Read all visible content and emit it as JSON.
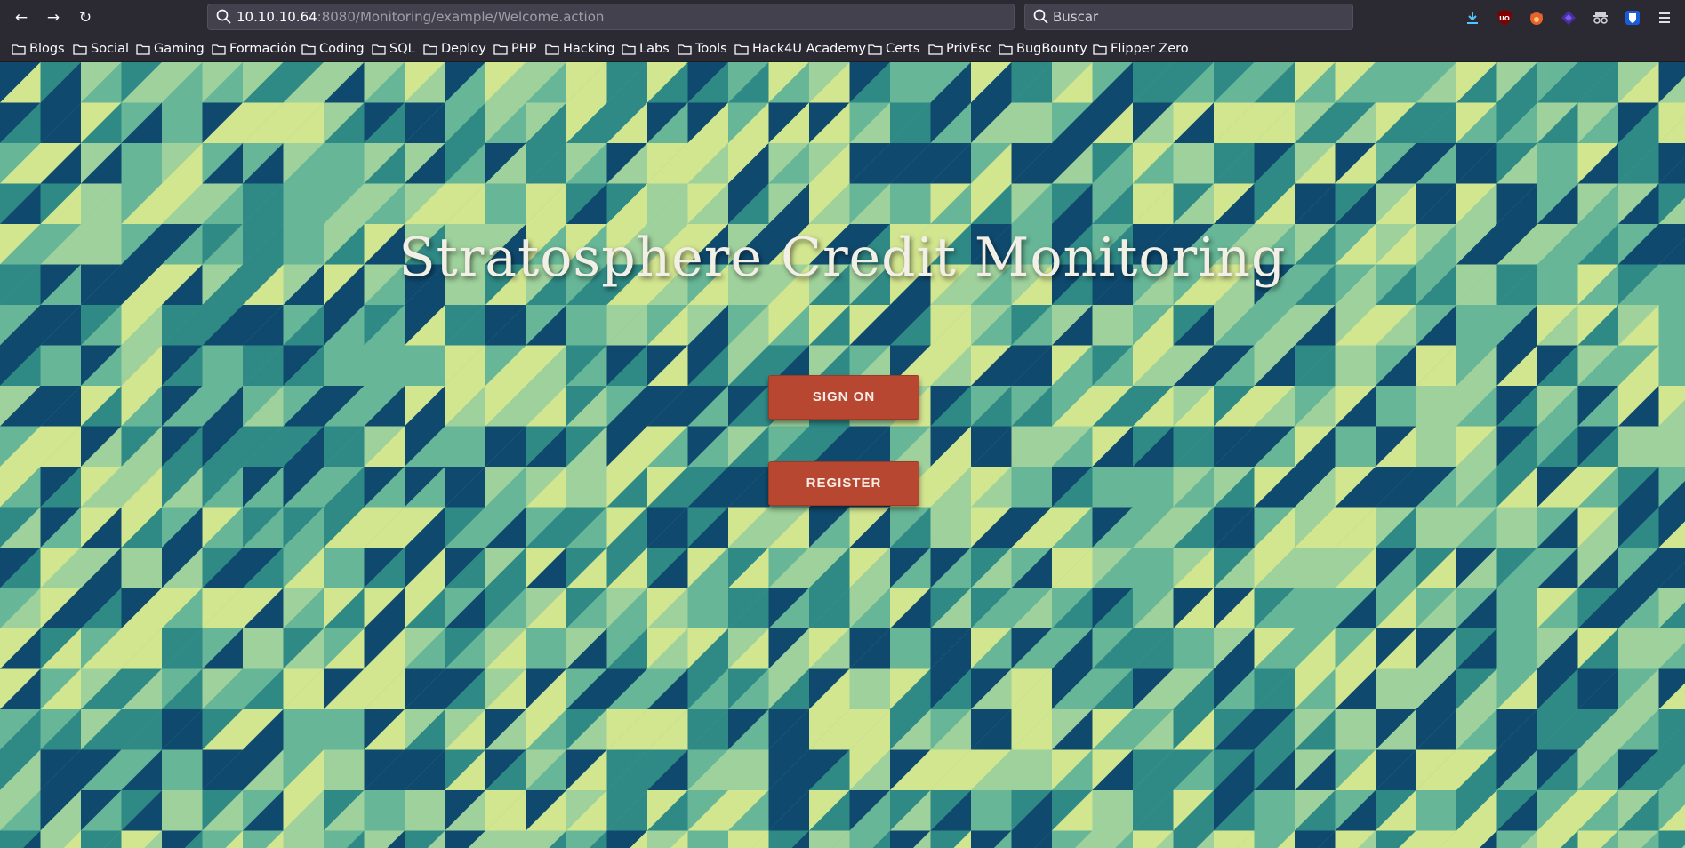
{
  "browser": {
    "url_host": "10.10.10.64",
    "url_rest": ":8080/Monitoring/example/Welcome.action",
    "search_placeholder": "Buscar",
    "bookmarks": [
      "Blogs",
      "Social",
      "Gaming",
      "Formación",
      "Coding",
      "SQL",
      "Deploy",
      "PHP",
      "Hacking",
      "Labs",
      "Tools",
      "Hack4U Academy",
      "Certs",
      "PrivEsc",
      "BugBounty",
      "Flipper Zero"
    ],
    "extension_icons": [
      "download-icon",
      "ublock-icon",
      "foxyproxy-icon",
      "wappalyzer-icon",
      "spy-icon",
      "bitwarden-icon",
      "menu-icon"
    ]
  },
  "page": {
    "title": "Stratosphere Credit Monitoring",
    "sign_on_label": "SIGN ON",
    "register_label": "REGISTER",
    "button_color": "#b84732",
    "pattern_colors": [
      "#0f4a6e",
      "#2f8a86",
      "#66b697",
      "#9fd19c",
      "#d2e58f"
    ]
  }
}
